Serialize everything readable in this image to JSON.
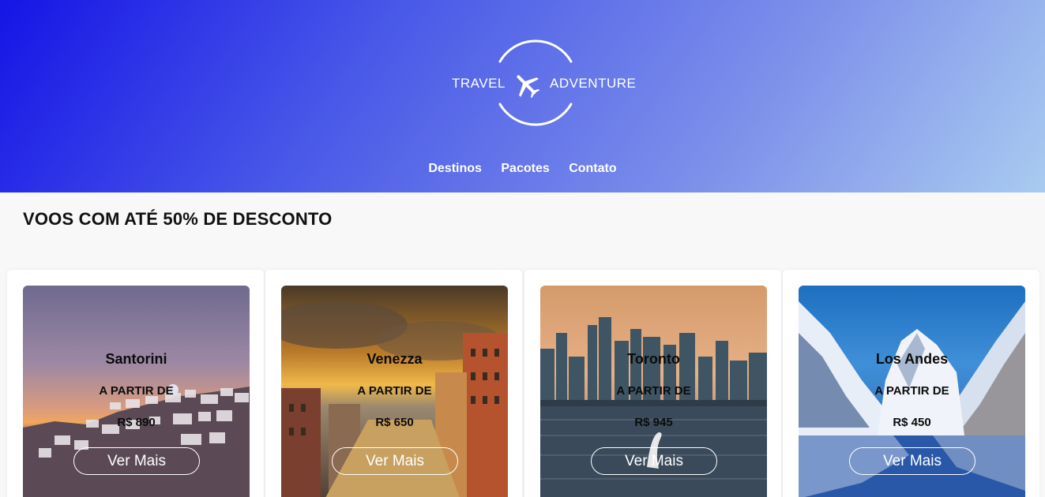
{
  "logo": {
    "left_word": "TRAVEL",
    "right_word": "ADVENTURE",
    "icon": "airplane-icon"
  },
  "nav": {
    "items": [
      "Destinos",
      "Pacotes",
      "Contato"
    ]
  },
  "section": {
    "title": "VOOS COM ATÉ 50% DE DESCONTO"
  },
  "cards": [
    {
      "name": "Santorini",
      "from_label": "A PARTIR DE",
      "price": "R$ 890",
      "button": "Ver Mais"
    },
    {
      "name": "Venezza",
      "from_label": "A PARTIR DE",
      "price": "R$ 650",
      "button": "Ver Mais"
    },
    {
      "name": "Toronto",
      "from_label": "A PARTIR DE",
      "price": "R$ 945",
      "button": "Ver Mais"
    },
    {
      "name": "Los Andes",
      "from_label": "A PARTIR DE",
      "price": "R$ 450",
      "button": "Ver Mais"
    }
  ],
  "colors": {
    "hero_start": "#1515e6",
    "hero_end": "#a9cbf0",
    "page_bg": "#f8f8f8",
    "card_bg": "#ffffff"
  }
}
